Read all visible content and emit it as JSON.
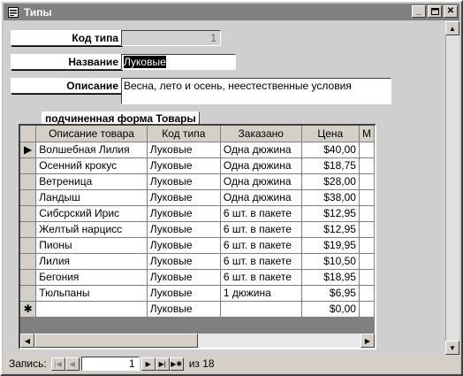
{
  "window": {
    "title": "Типы"
  },
  "form": {
    "code_label": "Код типа",
    "code_value": "1",
    "name_label": "Название",
    "name_value": "Луковые",
    "desc_label": "Описание",
    "desc_value": "Весна, лето и осень, неестественные условия"
  },
  "subform": {
    "caption": "подчиненная форма Товары",
    "columns": [
      "Описание товара",
      "Код типа",
      "Заказано",
      "Цена",
      "М"
    ],
    "rows": [
      [
        "Волшебная Лилия",
        "Луковые",
        "Одна дюжина",
        "$40,00"
      ],
      [
        "Осенний крокус",
        "Луковые",
        "Одна дюжина",
        "$18,75"
      ],
      [
        "Ветреница",
        "Луковые",
        "Одна дюжина",
        "$28,00"
      ],
      [
        "Ландыш",
        "Луковые",
        "Одна дюжина",
        "$38,00"
      ],
      [
        "Сибсрский Ирис",
        "Луковые",
        "6 шт. в пакете",
        "$12,95"
      ],
      [
        "Желтый нарцисс",
        "Луковые",
        "6 шт. в пакете",
        "$12,95"
      ],
      [
        "Пионы",
        "Луковые",
        "6 шт. в пакете",
        "$19,95"
      ],
      [
        "Лилия",
        "Луковые",
        "6 шт. в пакете",
        "$10,50"
      ],
      [
        "Бегония",
        "Луковые",
        "6 шт. в пакете",
        "$18,95"
      ],
      [
        "Тюльпаны",
        "Луковые",
        "1 дюжина",
        "$6,95"
      ]
    ],
    "new_row": [
      "",
      "Луковые",
      "",
      "$0,00"
    ],
    "current_marker": "▶",
    "new_marker": "✱"
  },
  "navigation": {
    "label": "Запись:",
    "current": "1",
    "of_text": "из  18"
  }
}
